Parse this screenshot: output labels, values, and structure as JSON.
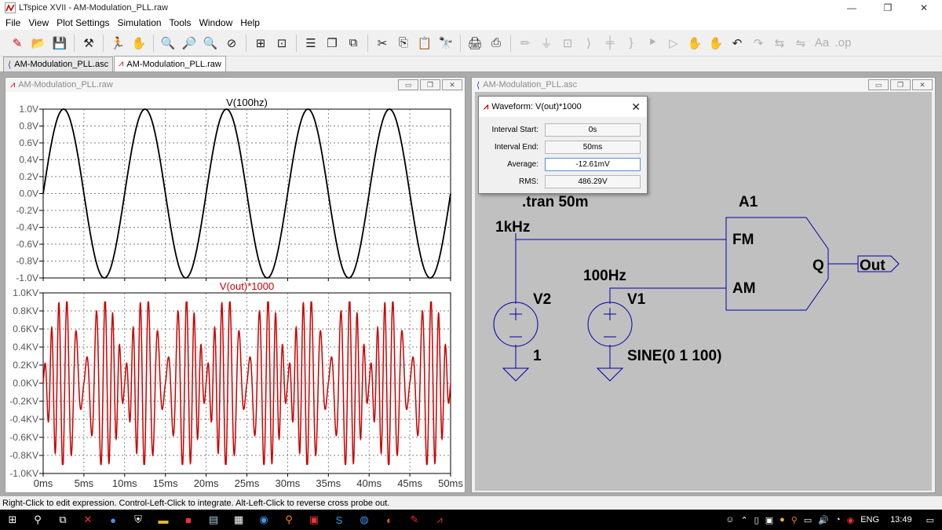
{
  "window": {
    "title": "LTspice XVII - AM-Modulation_PLL.raw"
  },
  "menu": [
    "File",
    "View",
    "Plot Settings",
    "Simulation",
    "Tools",
    "Window",
    "Help"
  ],
  "tabs": [
    {
      "label": "AM-Modulation_PLL.asc",
      "icon": "schematic-icon"
    },
    {
      "label": "AM-Modulation_PLL.raw",
      "icon": "waveform-icon",
      "active": true
    }
  ],
  "plot_window": {
    "title": "AM-Modulation_PLL.raw"
  },
  "schematic_window": {
    "title": "AM-Modulation_PLL.asc"
  },
  "dialog": {
    "title": "Waveform: V(out)*1000",
    "interval_start_label": "Interval Start:",
    "interval_start": "0s",
    "interval_end_label": "Interval End:",
    "interval_end": "50ms",
    "average_label": "Average:",
    "average": "-12.61mV",
    "rms_label": "RMS:",
    "rms": "486.29V"
  },
  "schematic": {
    "directive": ".tran 50m",
    "block_name": "A1",
    "pin_fm": "FM",
    "pin_am": "AM",
    "pin_q": "Q",
    "port_out": "Out",
    "v2_name": "V2",
    "v2_value": "1",
    "v2_net_label": "1kHz",
    "v1_name": "V1",
    "v1_value": "SINE(0 1 100)",
    "v1_net_label": "100Hz"
  },
  "status": "Right-Click to edit expression. Control-Left-Click to integrate. Alt-Left-Click to reverse cross probe out.",
  "taskbar": {
    "lang": "ENG",
    "time": "13:49"
  },
  "colors": {
    "trace_top": "#000000",
    "trace_bottom": "#cc0000",
    "schematic_bg": "#c0c0c0",
    "wire": "#0000aa"
  },
  "chart_data": [
    {
      "type": "line",
      "title": "V(100hz)",
      "title_color": "#000000",
      "x_unit": "ms",
      "xlim": [
        0,
        50
      ],
      "ylim": [
        -1.0,
        1.0
      ],
      "yticks": [
        "1.0V",
        "0.8V",
        "0.6V",
        "0.4V",
        "0.2V",
        "0.0V",
        "-0.2V",
        "-0.4V",
        "-0.6V",
        "-0.8V",
        "-1.0V"
      ],
      "grid": true,
      "series": [
        {
          "name": "V(100hz)",
          "expression": "sin(2*pi*100*t)",
          "amplitude": 1.0,
          "frequency_hz": 100
        }
      ]
    },
    {
      "type": "line",
      "title": "V(out)*1000",
      "title_color": "#cc0000",
      "x_unit": "ms",
      "xlim": [
        0,
        50
      ],
      "ylim": [
        -1.0,
        1.0
      ],
      "yticks": [
        "1.0KV",
        "0.8KV",
        "0.6KV",
        "0.4KV",
        "0.2KV",
        "0.0KV",
        "-0.2KV",
        "-0.4KV",
        "-0.6KV",
        "-0.8KV",
        "-1.0KV"
      ],
      "xticks": [
        "0ms",
        "5ms",
        "10ms",
        "15ms",
        "20ms",
        "25ms",
        "30ms",
        "35ms",
        "40ms",
        "45ms",
        "50ms"
      ],
      "grid": true,
      "series": [
        {
          "name": "V(out)*1000",
          "carrier_hz": 1000,
          "modulation_hz": 100,
          "peak_kv": 0.9
        }
      ]
    }
  ]
}
